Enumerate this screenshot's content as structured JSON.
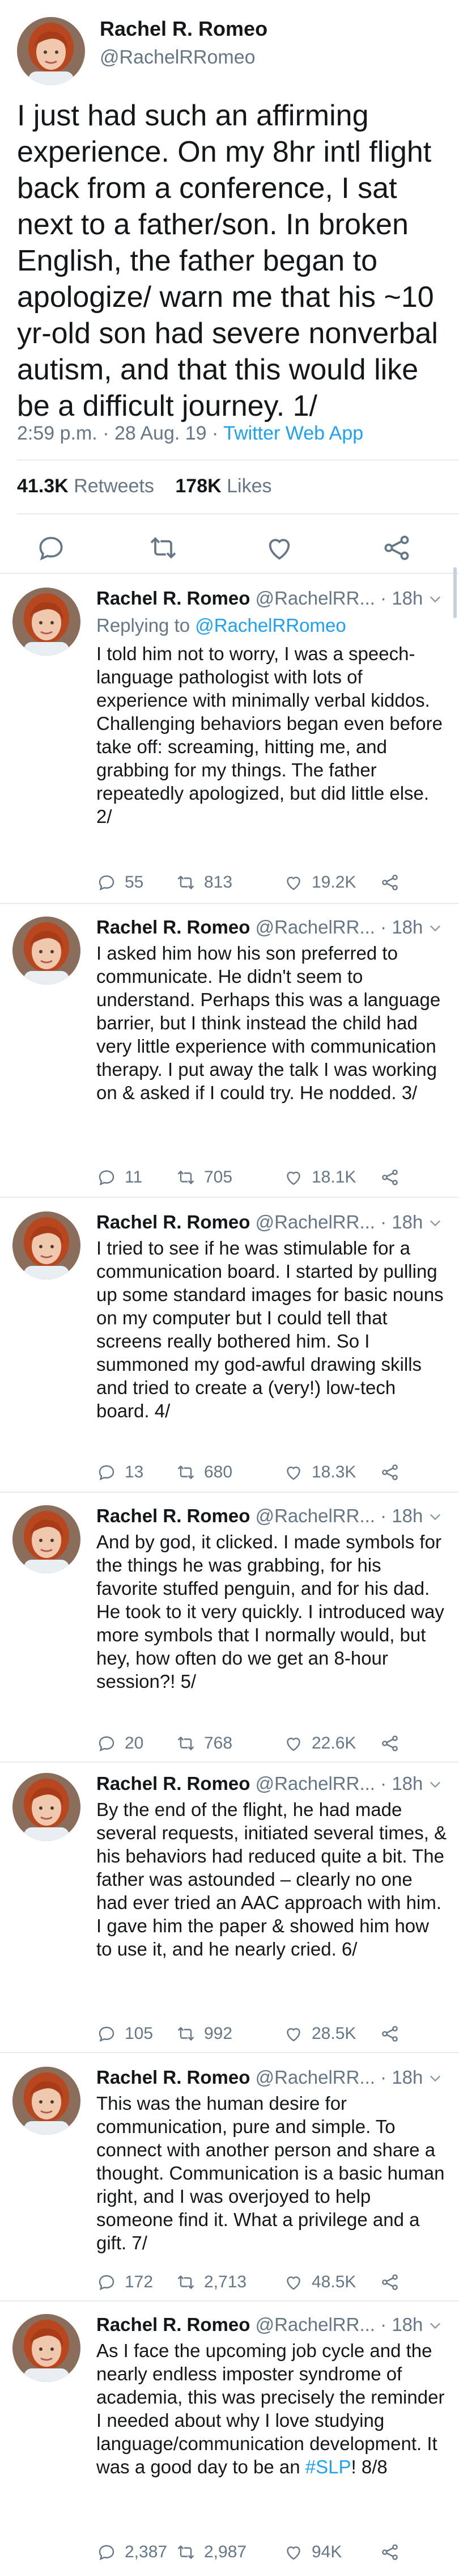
{
  "main_tweet": {
    "name": "Rachel R. Romeo",
    "handle": "@RachelRRomeo",
    "text": "I just had such an affirming experience. On my 8hr intl flight back from a conference, I sat next to a father/son. In broken English, the father began to apologize/ warn me that his ~10 yr-old son had severe nonverbal autism, and that this would like be a difficult journey. 1/",
    "time": "2:59 p.m.",
    "date": "28 Aug. 19",
    "separator": "·",
    "source": "Twitter Web App",
    "retweets_count": "41.3K",
    "retweets_label": "Retweets",
    "likes_count": "178K",
    "likes_label": "Likes",
    "action_icons": [
      "reply-icon",
      "retweet-icon",
      "like-icon",
      "share-icon"
    ]
  },
  "replies": [
    {
      "name": "Rachel R. Romeo",
      "handle": "@RachelRR...",
      "dot": "·",
      "time": "18h",
      "replying_prefix": "Replying to",
      "replying_to": "@RachelRRomeo",
      "text": "I told him not to worry, I was a speech-language pathologist with lots of experience with minimally verbal kiddos. Challenging behaviors began even before take off: screaming, hitting me, and grabbing for my things. The father repeatedly apologized, but did little else. 2/",
      "replies": "55",
      "retweets": "813",
      "likes": "19.2K"
    },
    {
      "name": "Rachel R. Romeo",
      "handle": "@RachelRR...",
      "dot": "·",
      "time": "18h",
      "text": "I asked him how his son preferred to communicate. He didn't seem to understand. Perhaps this was a language barrier, but I think instead the child had very little experience with communication therapy. I put away the talk I was working on & asked if I could try. He nodded. 3/",
      "replies": "11",
      "retweets": "705",
      "likes": "18.1K"
    },
    {
      "name": "Rachel R. Romeo",
      "handle": "@RachelRR...",
      "dot": "·",
      "time": "18h",
      "text": "I tried to see if he was stimulable for a communication board. I started by pulling up some standard images for basic nouns on my computer but I could tell that screens really bothered him. So I summoned my god-awful drawing skills and tried to create a (very!) low-tech board. 4/",
      "replies": "13",
      "retweets": "680",
      "likes": "18.3K"
    },
    {
      "name": "Rachel R. Romeo",
      "handle": "@RachelRR...",
      "dot": "·",
      "time": "18h",
      "text": "And by god, it clicked. I made symbols for the things he was grabbing, for his favorite stuffed penguin, and for his dad. He took to it very quickly. I introduced way more symbols that I normally would, but hey, how often do we get an 8-hour session?! 5/",
      "replies": "20",
      "retweets": "768",
      "likes": "22.6K"
    },
    {
      "name": "Rachel R. Romeo",
      "handle": "@RachelRR...",
      "dot": "·",
      "time": "18h",
      "text": "By the end of the flight, he had made several requests, initiated several times, & his behaviors had reduced quite a bit. The father was astounded – clearly no one had ever tried an AAC approach with him. I gave him the paper & showed him how to use it, and he nearly cried. 6/",
      "replies": "105",
      "retweets": "992",
      "likes": "28.5K"
    },
    {
      "name": "Rachel R. Romeo",
      "handle": "@RachelRR...",
      "dot": "·",
      "time": "18h",
      "text": "This was the human desire for communication, pure and simple. To connect with another person and share a thought. Communication is a basic human right, and I was overjoyed to help someone find it. What a privilege and a gift. 7/",
      "replies": "172",
      "retweets": "2,713",
      "likes": "48.5K"
    },
    {
      "name": "Rachel R. Romeo",
      "handle": "@RachelRR...",
      "dot": "·",
      "time": "18h",
      "text_before": "As I face the upcoming job cycle and the nearly endless imposter syndrome of academia, this was precisely the reminder I needed about why I love studying language/communication development. It was a good day to be an ",
      "hashtag": "#SLP",
      "text_after": "! 8/8",
      "replies": "2,387",
      "retweets": "2,987",
      "likes": "94K"
    }
  ],
  "colors": {
    "text": "#14171a",
    "muted": "#657786",
    "accent": "#1da1f2",
    "divider": "#e6ecf0"
  }
}
